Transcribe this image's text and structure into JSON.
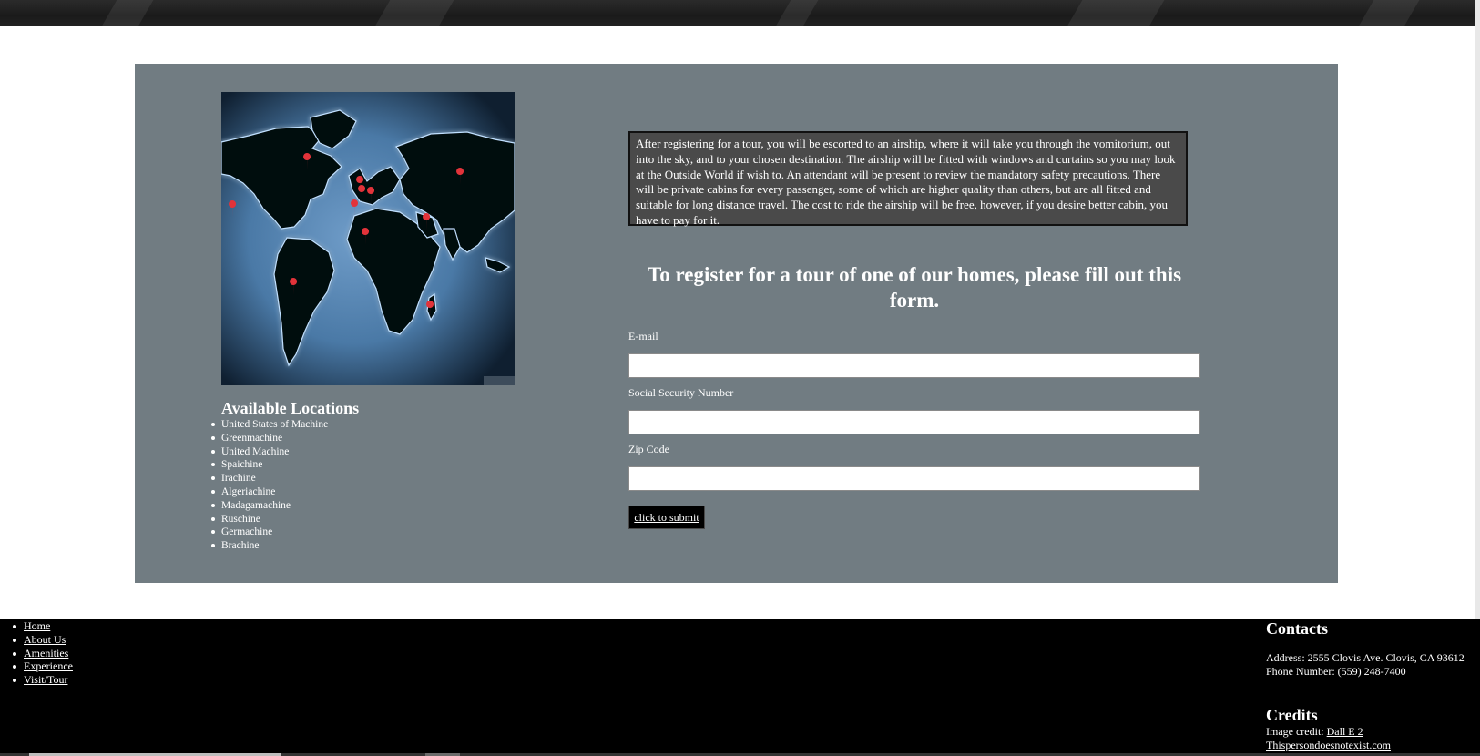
{
  "locations": {
    "heading": "Available Locations",
    "items": [
      "United States of Machine",
      "Greenmachine",
      "United Machine",
      "Spaichine",
      "Irachine",
      "Algeriachine",
      "Madagamachine",
      "Ruschine",
      "Germachine",
      "Brachine"
    ]
  },
  "info": {
    "text": "After registering for a tour, you will be escorted to an airship, where it will take you through the vomitorium, out into the sky, and to your chosen destination. The airship will be fitted with windows and curtains so you may look at the Outside World if wish to. An attendant will be present to review the mandatory safety precautions. There will be private cabins for every passenger, some of which are higher quality than others, but are all fitted and suitable for long distance travel. The cost to ride the airship will be free, however, if you desire better cabin, you have to pay for it."
  },
  "form": {
    "heading": "To register for a tour of one of our homes, please fill out this form.",
    "email_label": "E-mail",
    "email_value": "",
    "ssn_label": "Social Security Number",
    "ssn_value": "",
    "zip_label": "Zip Code",
    "zip_value": "",
    "submit_label": "click to submit"
  },
  "footer": {
    "nav": [
      "Home",
      "About Us",
      "Amenities",
      "Experience",
      "Visit/Tour"
    ],
    "contacts_heading": "Contacts",
    "address": "Address: 2555 Clovis Ave. Clovis, CA 93612",
    "phone": "Phone Number: (559) 248-7400",
    "credits_heading": "Credits",
    "image_credit_prefix": "Image credit: ",
    "image_credit_link": "Dall E 2",
    "credit_link_2": "Thispersondoesnotexist.com"
  },
  "colors": {
    "panel": "#717c82",
    "info_box": "#4a4a4a",
    "footer": "#000000",
    "map_pin": "#e2333a"
  }
}
